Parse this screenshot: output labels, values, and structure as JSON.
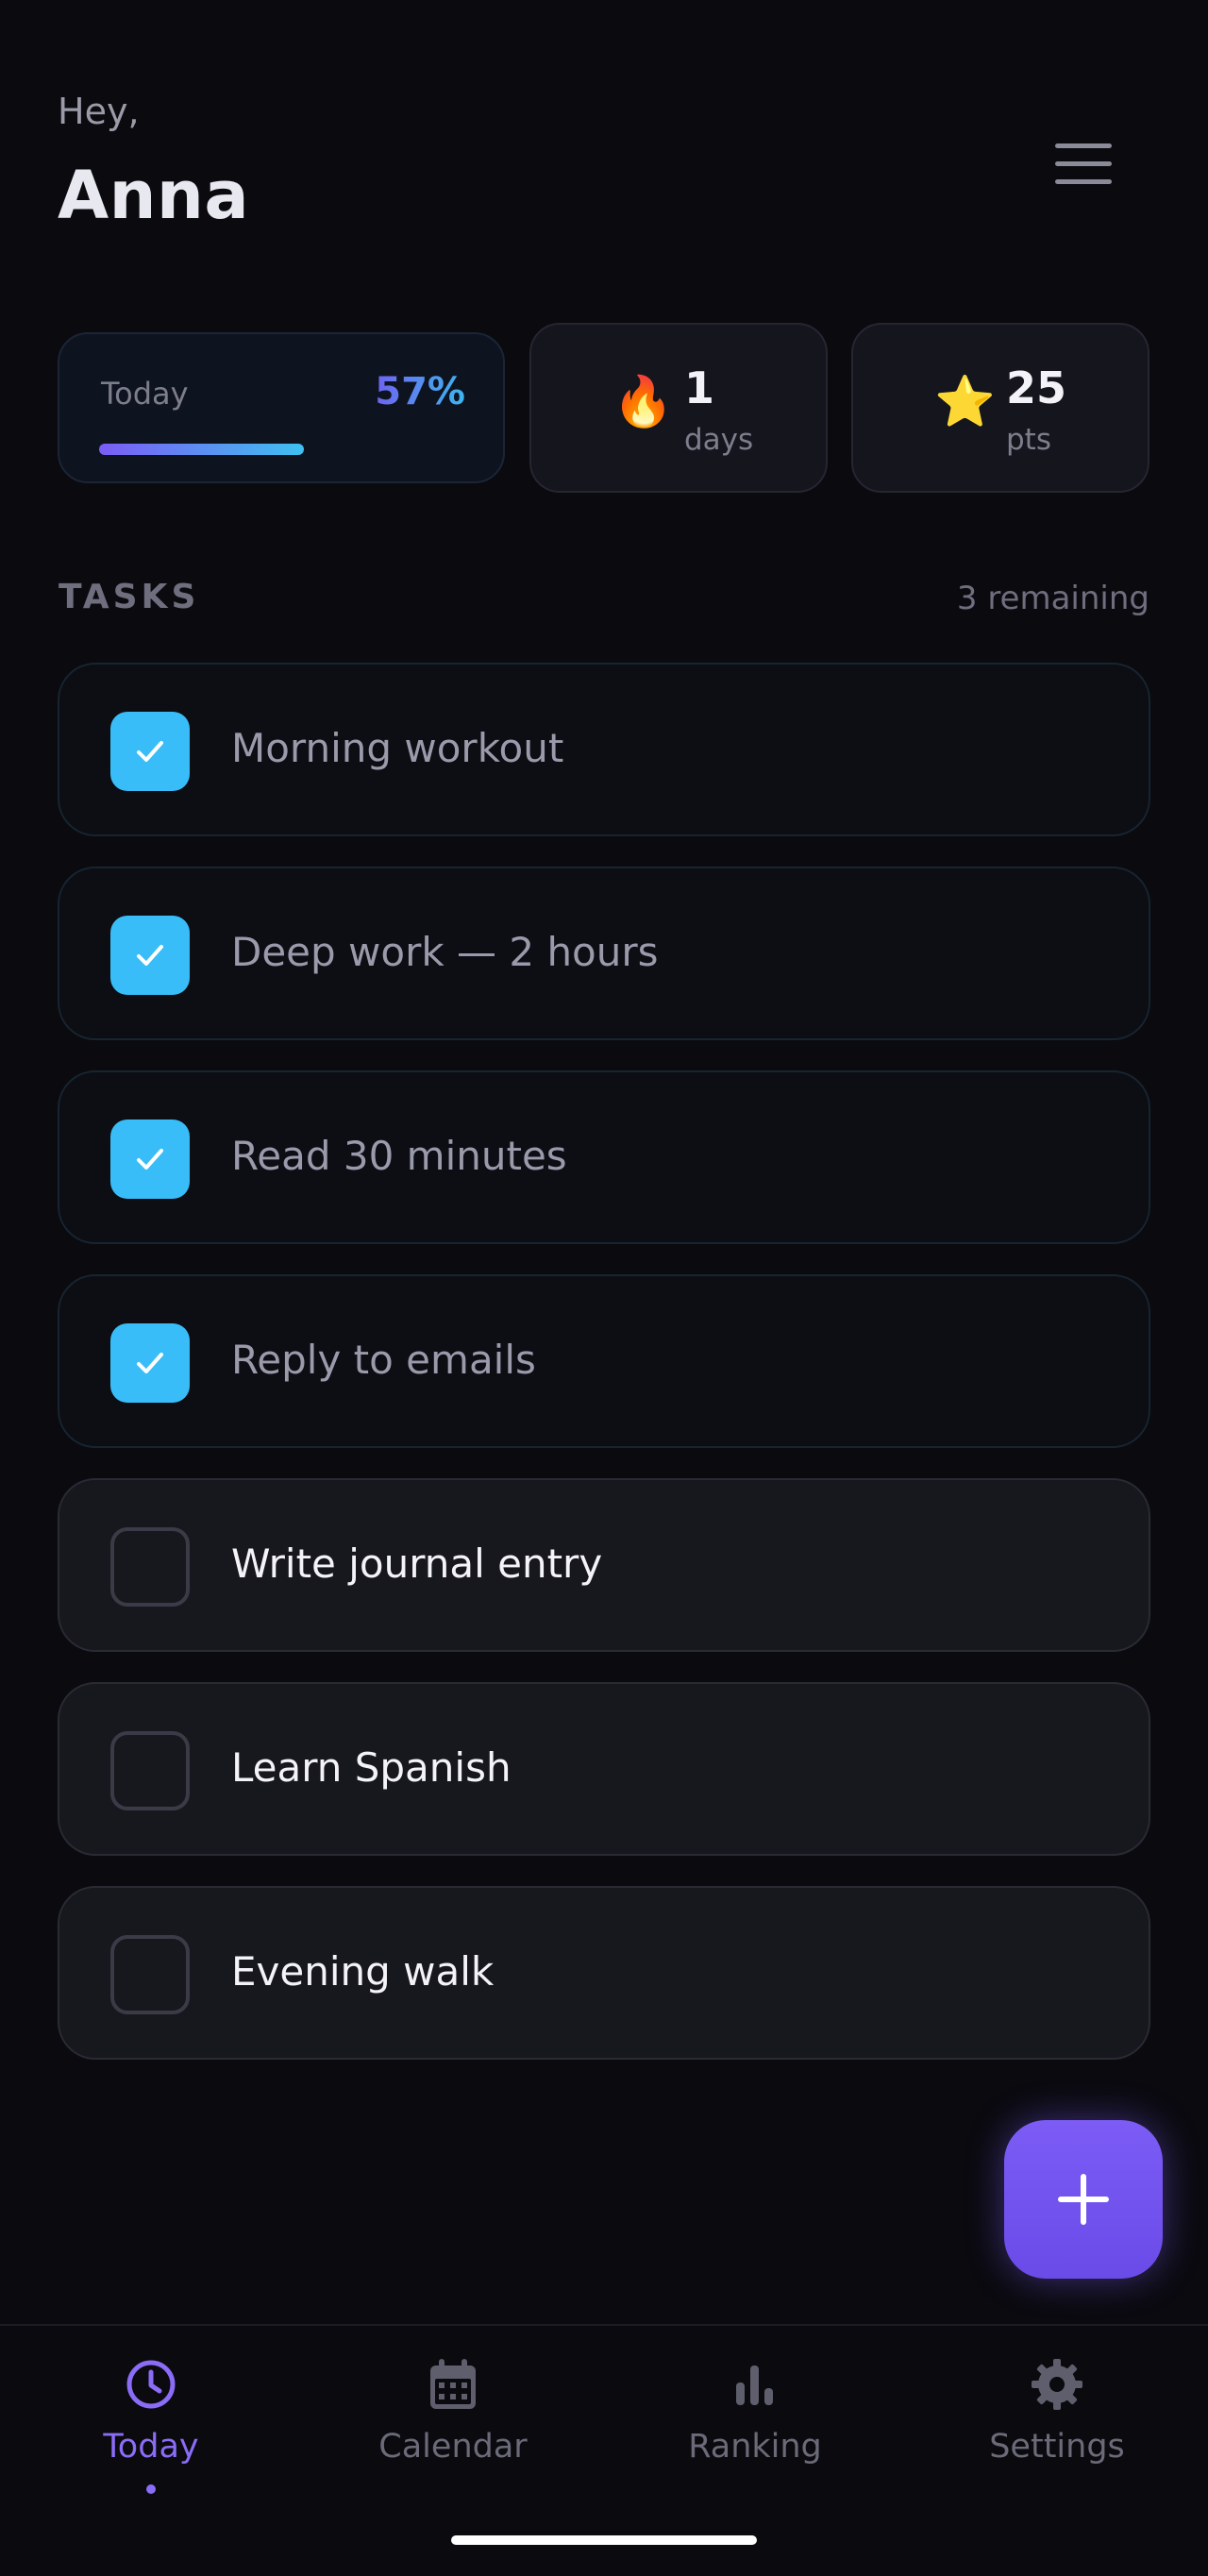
{
  "header": {
    "greeting": "Hey,",
    "user_name": "Anna",
    "menu_icon": "hamburger-menu-icon"
  },
  "stats": {
    "today": {
      "label": "Today",
      "percent_text": "57%",
      "progress": 0.57
    },
    "streak": {
      "icon": "fire-icon",
      "emoji": "🔥",
      "value": "1",
      "unit": "days"
    },
    "points": {
      "icon": "star-icon",
      "emoji": "⭐",
      "value": "25",
      "unit": "pts"
    }
  },
  "tasks": {
    "heading": "TASKS",
    "remaining": "3 remaining",
    "items": [
      {
        "label": "Morning workout",
        "done": true
      },
      {
        "label": "Deep work — 2 hours",
        "done": true
      },
      {
        "label": "Read 30 minutes",
        "done": true
      },
      {
        "label": "Reply to emails",
        "done": true
      },
      {
        "label": "Write journal entry",
        "done": false
      },
      {
        "label": "Learn Spanish",
        "done": false
      },
      {
        "label": "Evening walk",
        "done": false
      }
    ]
  },
  "fab": {
    "icon": "plus-icon"
  },
  "nav": {
    "items": [
      {
        "label": "Today",
        "icon": "clock-icon",
        "active": true
      },
      {
        "label": "Calendar",
        "icon": "calendar-icon",
        "active": false
      },
      {
        "label": "Ranking",
        "icon": "bar-chart-icon",
        "active": false
      },
      {
        "label": "Settings",
        "icon": "gear-icon",
        "active": false
      }
    ]
  },
  "colors": {
    "background": "#0a0a0f",
    "accent_purple": "#8b6cf6",
    "accent_cyan": "#38bdf8",
    "muted_text": "#6e6e7e"
  }
}
